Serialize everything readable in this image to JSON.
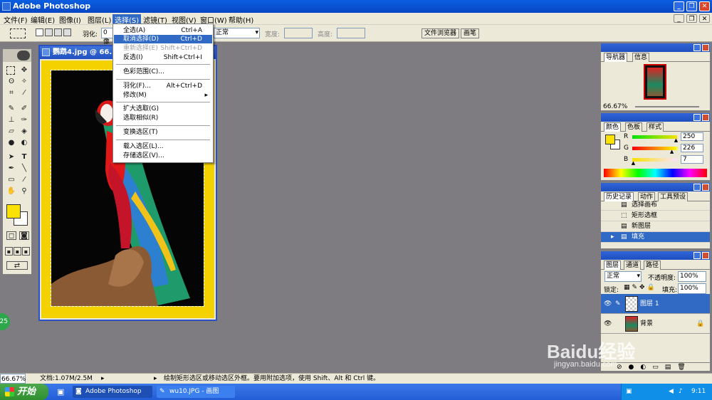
{
  "app": {
    "title": "Adobe Photoshop",
    "window_buttons": {
      "minimize": "_",
      "restore": "❐",
      "close": "✕"
    }
  },
  "menubar": {
    "items": [
      "文件(F)",
      "编辑(E)",
      "图像(I)",
      "图层(L)",
      "选择(S)",
      "滤镜(T)",
      "视图(V)",
      "窗口(W)",
      "帮助(H)"
    ],
    "active_index": 4
  },
  "options_bar": {
    "feather_label": "羽化:",
    "feather_value": "0 像",
    "mode_value": "正常",
    "width_label": "宽度:",
    "height_label": "高度:",
    "file_browser_tab": "文件浏览器",
    "brushes_tab": "画笔"
  },
  "select_menu": {
    "items": [
      {
        "label": "全选(A)",
        "shortcut": "Ctrl+A",
        "state": "normal"
      },
      {
        "label": "取消选择(D)",
        "shortcut": "Ctrl+D",
        "state": "highlighted"
      },
      {
        "label": "重新选择(E)",
        "shortcut": "Shift+Ctrl+D",
        "state": "disabled"
      },
      {
        "label": "反选(I)",
        "shortcut": "Shift+Ctrl+I",
        "state": "normal"
      },
      {
        "label": "色彩范围(C)...",
        "shortcut": "",
        "state": "normal"
      },
      {
        "label": "羽化(F)...",
        "shortcut": "Alt+Ctrl+D",
        "state": "normal"
      },
      {
        "label": "修改(M)",
        "shortcut": "▸",
        "state": "normal"
      },
      {
        "label": "扩大选取(G)",
        "shortcut": "",
        "state": "normal"
      },
      {
        "label": "选取相似(R)",
        "shortcut": "",
        "state": "normal"
      },
      {
        "label": "变换选区(T)",
        "shortcut": "",
        "state": "normal"
      },
      {
        "label": "载入选区(L)...",
        "shortcut": "",
        "state": "normal"
      },
      {
        "label": "存储选区(V)...",
        "shortcut": "",
        "state": "normal"
      }
    ]
  },
  "document": {
    "title": "鹦鹉4.jpg @ 66.",
    "background_color": "#f4d200"
  },
  "navigator": {
    "tabs": [
      "导航器",
      "信息"
    ],
    "zoom": "66.67%"
  },
  "color_panel": {
    "tabs": [
      "颜色",
      "色板",
      "样式"
    ],
    "channels": [
      {
        "label": "R",
        "value": "250",
        "level": 0.98
      },
      {
        "label": "G",
        "value": "226",
        "level": 0.886
      },
      {
        "label": "B",
        "value": "7",
        "level": 0.027
      }
    ],
    "foreground": "#fae207",
    "background": "#ffffff"
  },
  "history_panel": {
    "tabs": [
      "历史记录",
      "动作",
      "工具预设"
    ],
    "items": [
      "选择画布",
      "矩形选框",
      "新图层",
      "填充"
    ],
    "selected_index": 3
  },
  "layers_panel": {
    "tabs": [
      "图层",
      "通道",
      "路径"
    ],
    "blend_mode": "正常",
    "opacity_label": "不透明度:",
    "opacity_value": "100%",
    "lock_label": "锁定:",
    "fill_label": "填充:",
    "fill_value": "100%",
    "layers": [
      "图层 1",
      "背景"
    ],
    "selected_index": 0
  },
  "status_bar": {
    "zoom": "66.67%",
    "doc_info": "文档:1.07M/2.5M",
    "hint": "绘制矩形选区或移动选区外框。要用附加选项，使用 Shift、Alt 和 Ctrl 键。"
  },
  "taskbar": {
    "start_label": "开始",
    "items": [
      "Adobe Photoshop",
      "wu10.JPG - 画图"
    ],
    "clock": "9:11"
  },
  "watermark": {
    "text": "Baidu经验",
    "url": "jingyan.baidu.com"
  },
  "side_badge": "25"
}
